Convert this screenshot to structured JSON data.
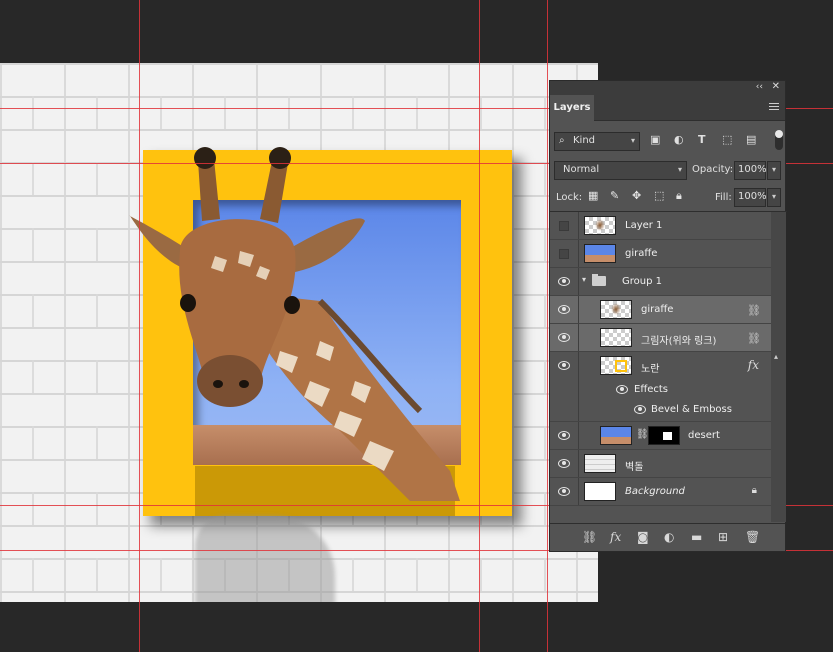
{
  "panel": {
    "tab_label": "Layers",
    "collapse_glyph": "‹‹",
    "close_glyph": "✕",
    "filter": {
      "kind_label": "Kind"
    },
    "blend_mode": "Normal",
    "opacity_label": "Opacity:",
    "opacity_value": "100%",
    "lock_label": "Lock:",
    "fill_label": "Fill:",
    "fill_value": "100%"
  },
  "layers": [
    {
      "name": "Layer 1",
      "visible": false
    },
    {
      "name": "giraffe",
      "visible": false
    },
    {
      "name": "Group 1",
      "visible": true,
      "type": "group"
    },
    {
      "name": "giraffe",
      "visible": true,
      "selected": true,
      "linked": true
    },
    {
      "name": "그림자(위와 링크)",
      "visible": true,
      "selected": true,
      "linked": true
    },
    {
      "name": "노란",
      "visible": true,
      "has_fx": true
    },
    {
      "name": "Effects",
      "visible": true,
      "type": "effects-header"
    },
    {
      "name": "Bevel & Emboss",
      "visible": true,
      "type": "effect"
    },
    {
      "name": "desert",
      "visible": true,
      "has_mask": true
    },
    {
      "name": "벽돌",
      "visible": true
    },
    {
      "name": "Background",
      "visible": true,
      "locked": true
    }
  ],
  "colors": {
    "accent_frame": "#ffc20e",
    "guide": "#e0323a",
    "panel_bg": "#535353"
  }
}
